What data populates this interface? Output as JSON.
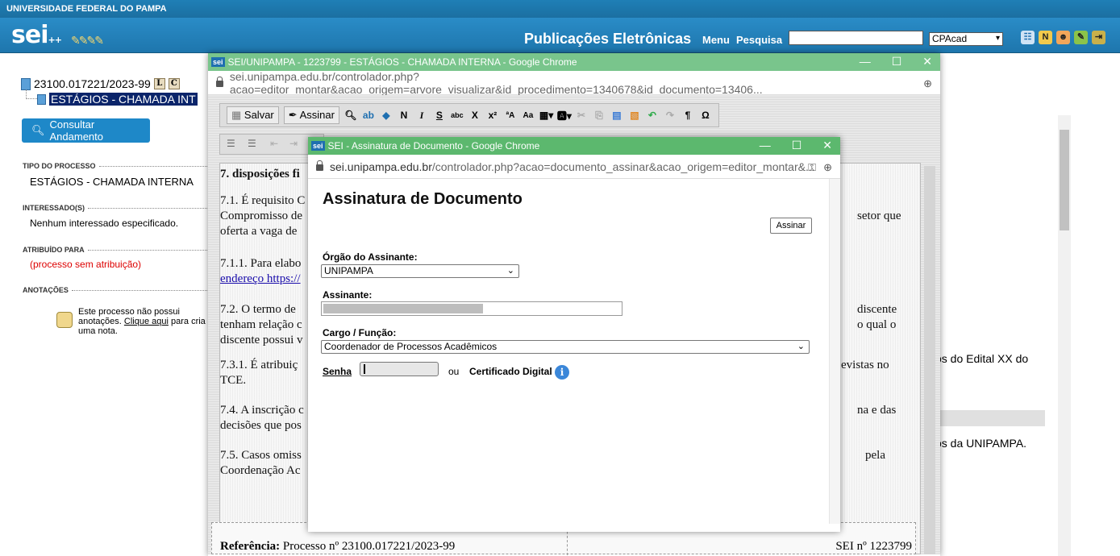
{
  "header": {
    "university": "UNIVERSIDADE FEDERAL DO PAMPA",
    "logo": "sei",
    "logo_suffix": "++",
    "title": "Publicações Eletrônicas",
    "menu": "Menu",
    "search_label": "Pesquisa",
    "search_value": "",
    "unit": "CPAcad",
    "icons": [
      "list-icon",
      "n-icon",
      "user-icon",
      "tools-icon",
      "exit-icon"
    ]
  },
  "tree": {
    "process": "23100.017221/2023-99",
    "btn_l": "L",
    "btn_c": "C",
    "document": "ESTÁGIOS - CHAMADA INT"
  },
  "sidebar": {
    "consult_btn": "Consultar Andamento",
    "tipo_label": "TIPO DO PROCESSO",
    "tipo_value": "ESTÁGIOS - CHAMADA INTERNA",
    "interessados_label": "INTERESSADO(S)",
    "interessados_value": "Nenhum interessado especificado.",
    "atribuido_label": "ATRIBUÍDO PARA",
    "atribuido_value": "(processo sem atribuição)",
    "anotacoes_label": "ANOTAÇÕES",
    "anotacoes_pre": "Este processo não possui anotações.",
    "anotacoes_link": "Clique aqui",
    "anotacoes_post": "para cria uma nota."
  },
  "background_text": {
    "line1": "os do Edital XX do",
    "line2": "os da UNIPAMPA."
  },
  "editor_window": {
    "title": "SEI/UNIPAMPA - 1223799 - ESTÁGIOS - CHAMADA INTERNA - Google Chrome",
    "favicon": "sei",
    "url": "sei.unipampa.edu.br/controlador.php?acao=editor_montar&acao_origem=arvore_visualizar&id_procedimento=1340678&id_documento=13406...",
    "toolbar": {
      "save": "Salvar",
      "sign": "Assinar",
      "bold": "N",
      "italic": "I",
      "strike": "S",
      "sub": "X",
      "sup": "x²",
      "omega": "Ω"
    },
    "doc": {
      "heading": "7. disposições fi",
      "p71a": "7.1. É requisito C",
      "p71b": "Compromisso de",
      "p71c": "oferta a vaga de",
      "p71r1": "setor que",
      "p711a": "7.1.1. Para elabo",
      "p711b": "endereço https://",
      "p72a": "7.2. O termo de",
      "p72b": "tenham relação c",
      "p72c": "discente possui v",
      "p72r1": "discente",
      "p72r2": "o qual o",
      "p731a": "7.3.1. É atribuiç",
      "p731b": "TCE.",
      "p731r": "evistas no",
      "p74a": "7.4. A inscrição c",
      "p74b": "decisões que pos",
      "p74r": "na e das",
      "p75a": "7.5. Casos omiss",
      "p75b": "Coordenação Ac",
      "p75r": "pela",
      "ref_label": "Referência:",
      "ref_value": "Processo nº 23100.017221/2023-99",
      "sei_no": "SEI nº 1223799"
    }
  },
  "sign_window": {
    "title": "SEI - Assinatura de Documento - Google Chrome",
    "favicon": "sei",
    "url_domain": "sei.unipampa.edu.br",
    "url_path": "/controlador.php?acao=documento_assinar&acao_origem=editor_montar&...",
    "heading": "Assinatura de Documento",
    "assinar_btn": "Assinar",
    "orgao_label": "Órgão do Assinante:",
    "orgao_value": "UNIPAMPA",
    "assinante_label": "Assinante:",
    "assinante_value": "",
    "cargo_label": "Cargo / Função:",
    "cargo_value": "Coordenador de Processos Acadêmicos",
    "senha_label": "Senha",
    "ou": "ou",
    "cert_label": "Certificado Digital",
    "info_icon": "i"
  }
}
